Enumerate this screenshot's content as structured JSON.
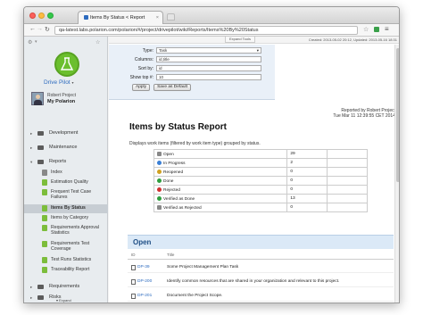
{
  "browser": {
    "tab_title": "Items By Status < Report",
    "url": "qa-latest.labs.polarion.com/polarion/#/project/drivepilot/wiki/Reports/Items%20By%20Status"
  },
  "sidebar": {
    "project_name": "Drive Pilot",
    "user_name": "Robert Project",
    "user_link": "My Polarion",
    "items": [
      {
        "label": "Development"
      },
      {
        "label": "Maintenance"
      },
      {
        "label": "Reports"
      }
    ],
    "reports_pages": [
      {
        "label": "Index"
      },
      {
        "label": "Estimation Quality"
      },
      {
        "label": "Frequent Test Case Failures"
      },
      {
        "label": "Items By Status"
      },
      {
        "label": "Items by Category"
      },
      {
        "label": "Requirements Approval Statistics"
      },
      {
        "label": "Requirements Test Coverage"
      },
      {
        "label": "Test Runs Statistics"
      },
      {
        "label": "Traceability Report"
      }
    ],
    "bottom_items": [
      {
        "label": "Requirements"
      },
      {
        "label": "Risks"
      }
    ],
    "expand_label": "Expand"
  },
  "header": {
    "expand_tools": "Expand Tools",
    "created": "Created: 2013-05-02 20:12, Updated: 2013-05-16 18:31"
  },
  "form": {
    "type_label": "Type:",
    "type_value": "Task",
    "columns_label": "Columns:",
    "columns_value": "id,title",
    "sortby_label": "Sort by:",
    "sortby_value": "id",
    "showtop_label": "Show top #:",
    "showtop_value": "10",
    "apply_label": "Apply",
    "save_default_label": "Save as Default"
  },
  "report": {
    "reported_by": "Reported by Robert Project",
    "date": "Tue Mar 11 12:39:55 CET 2014",
    "title": "Items by Status Report",
    "description": "Displays work items (filtered by work item type) grouped by status.",
    "statuses": [
      {
        "label": "Open",
        "count": "29",
        "icon": "open-icon",
        "color": "#888888"
      },
      {
        "label": "In Progress",
        "count": "2",
        "icon": "in-progress-icon",
        "color": "#3a7fd5"
      },
      {
        "label": "Reopened",
        "count": "0",
        "icon": "reopened-icon",
        "color": "#d0a020"
      },
      {
        "label": "Done",
        "count": "0",
        "icon": "done-icon",
        "color": "#2e9e3e"
      },
      {
        "label": "Rejected",
        "count": "0",
        "icon": "rejected-icon",
        "color": "#d03030"
      },
      {
        "label": "Verified as Done",
        "count": "13",
        "icon": "verified-icon",
        "color": "#2e9e3e"
      },
      {
        "label": "Verified as Rejected",
        "count": "0",
        "icon": "verified-rejected-icon",
        "color": "#888888"
      }
    ]
  },
  "open_section": {
    "heading": "Open",
    "col_id": "ID",
    "col_title": "Title",
    "rows": [
      {
        "id": "DP-39",
        "title": "Some Project Management Plan Task"
      },
      {
        "id": "DP-200",
        "title": "Identify common resources that are shared in your organization and relevant to this project."
      },
      {
        "id": "DP-201",
        "title": "Document the Project Scope."
      }
    ]
  },
  "colors": {
    "accent_blue": "#2d6bbf",
    "section_blue": "#dbe9f7",
    "sidebar_bg": "#e8ecef"
  }
}
